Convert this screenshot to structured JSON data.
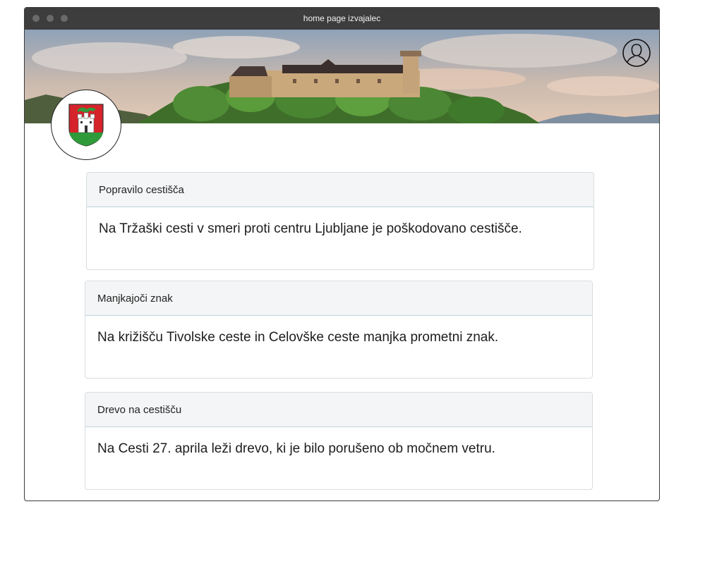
{
  "window": {
    "title": "home page izvajalec"
  },
  "header": {
    "user_icon": "user-profile-icon",
    "logo_icon": "ljubljana-coat-of-arms-icon"
  },
  "colors": {
    "titlebar": "#3d3d3d",
    "card_header_bg": "#f4f5f6",
    "card_border": "#d9dcdf",
    "card_header_divider": "#bfd3dd",
    "shield_red": "#d6232b",
    "shield_green": "#2f9a3a"
  },
  "reports": [
    {
      "title": "Popravilo cestišča",
      "text": "Na Tržaški cesti v smeri proti centru Ljubljane je poškodovano cestišče."
    },
    {
      "title": "Manjkajoči znak",
      "text": "Na križišču Tivolske ceste in Celovške ceste manjka prometni znak."
    },
    {
      "title": "Drevo na cestišču",
      "text": "Na Cesti 27. aprila leži drevo, ki je bilo porušeno ob močnem vetru."
    }
  ]
}
